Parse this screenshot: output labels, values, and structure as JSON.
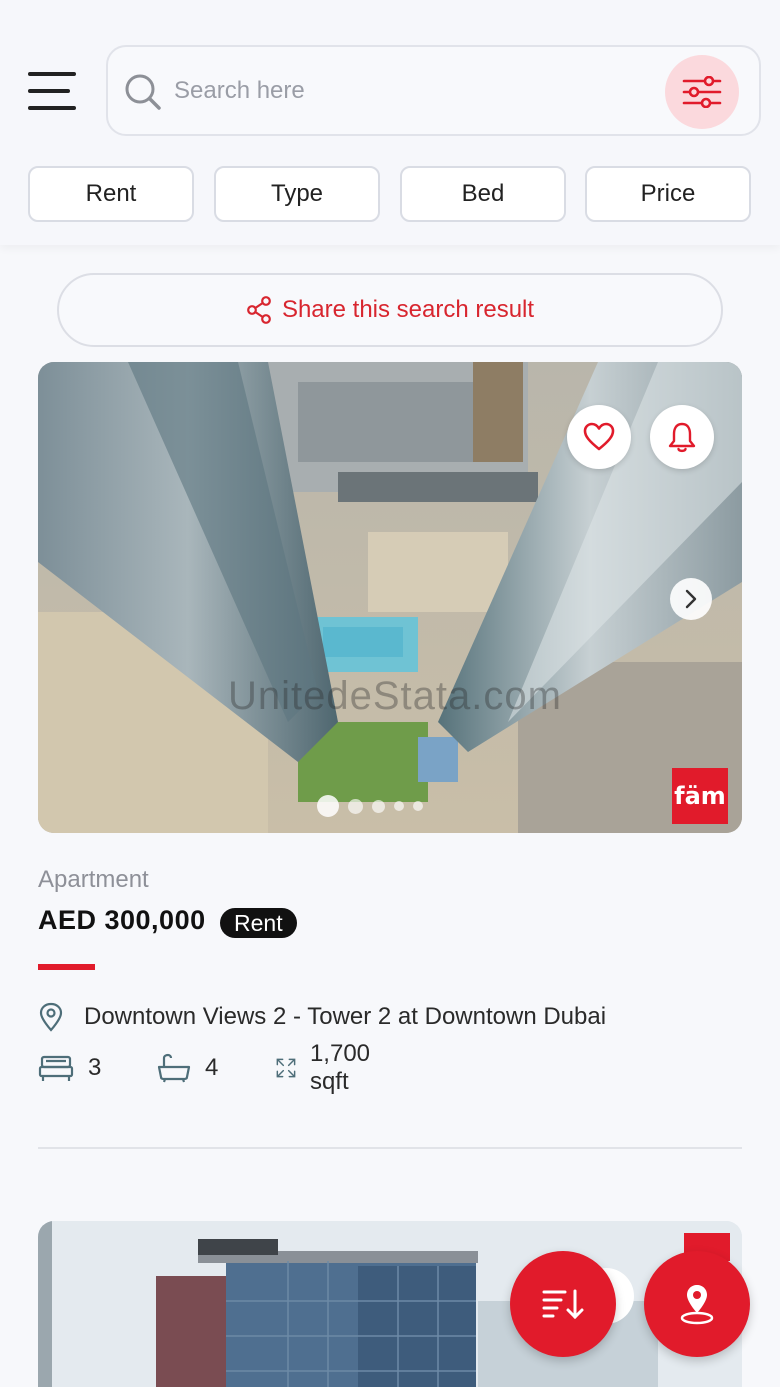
{
  "search": {
    "placeholder": "Search here"
  },
  "filters": [
    {
      "label": "Rent"
    },
    {
      "label": "Type"
    },
    {
      "label": "Bed"
    },
    {
      "label": "Price"
    }
  ],
  "share": {
    "label": "Share this search result"
  },
  "listing": {
    "property_type": "Apartment",
    "price": "AED 300,000",
    "deal_type": "Rent",
    "location": "Downtown Views 2 - Tower 2 at Downtown Dubai",
    "beds": "3",
    "baths": "4",
    "area": "1,700 sqft",
    "brand_badge": "fäm",
    "watermark": "UnitedeStata.com",
    "image_dots": 5,
    "active_dot": 1
  },
  "colors": {
    "accent": "#e11b2b",
    "filter_bg": "#fbd9dd"
  },
  "icons": {
    "menu": "hamburger-icon",
    "search": "search-icon",
    "filter": "sliders-icon",
    "share": "share-icon",
    "favorite": "heart-icon",
    "alert": "bell-icon",
    "next": "chevron-right-icon",
    "location": "location-pin-icon",
    "bed": "bed-icon",
    "bath": "bathtub-icon",
    "area": "expand-icon",
    "sort": "sort-icon",
    "map": "map-pin-icon"
  }
}
